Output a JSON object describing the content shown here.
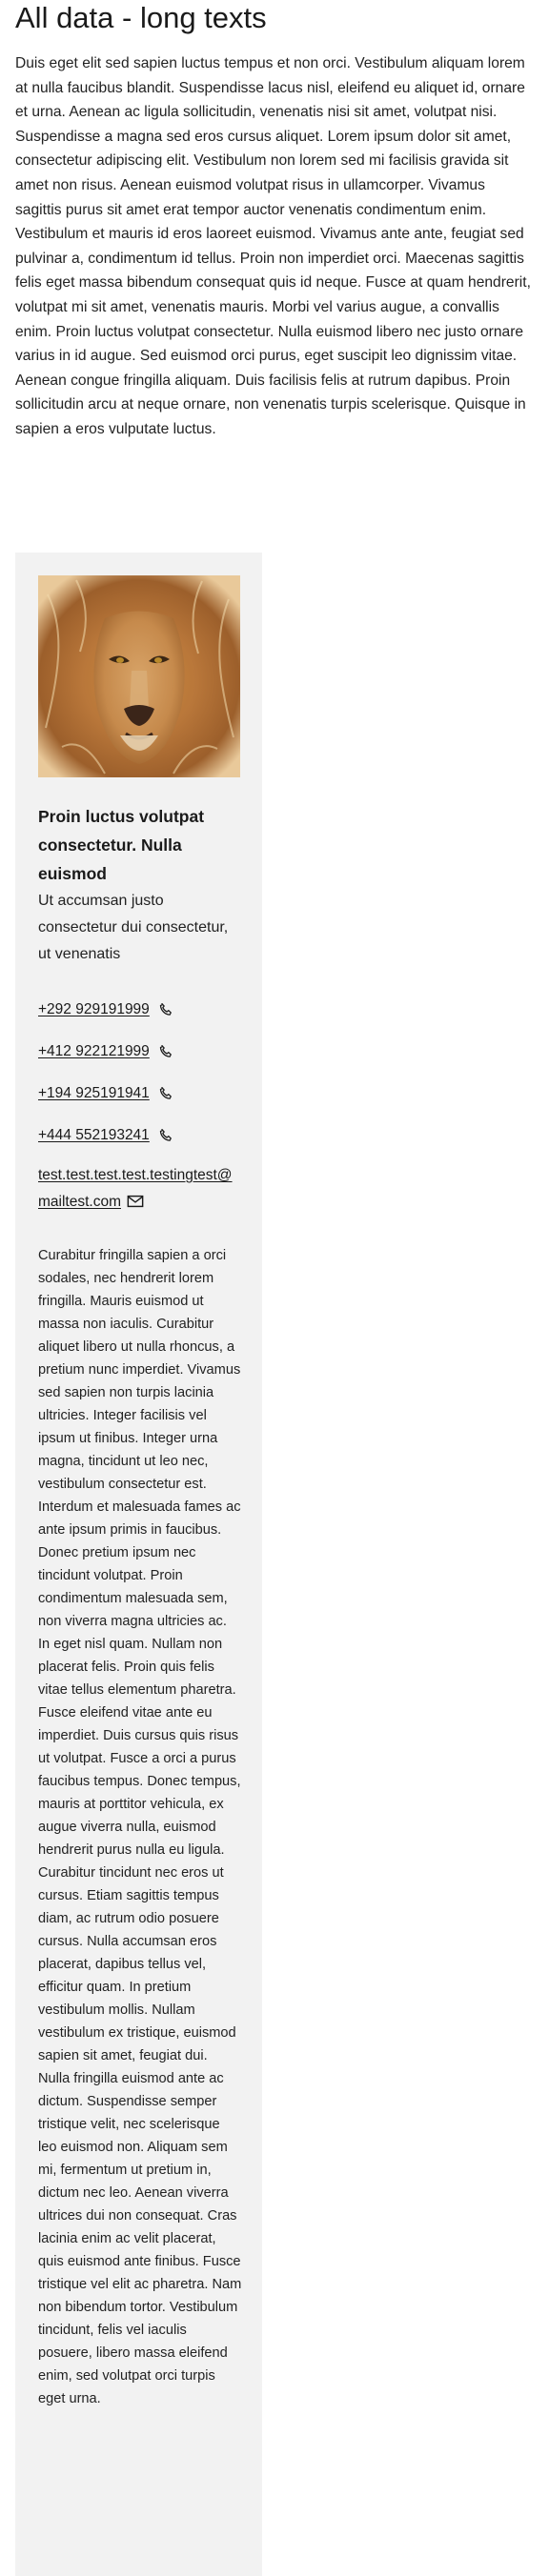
{
  "page": {
    "title": "All data - long texts",
    "intro": "Duis eget elit sed sapien luctus tempus et non orci. Vestibulum aliquam lorem at nulla faucibus blandit. Suspendisse lacus nisl, eleifend eu aliquet id, ornare et urna. Aenean ac ligula sollicitudin, venenatis nisi sit amet, volutpat nisi. Suspendisse a magna sed eros cursus aliquet. Lorem ipsum dolor sit amet, consectetur adipiscing elit. Vestibulum non lorem sed mi facilisis gravida sit amet non risus. Aenean euismod volutpat risus in ullamcorper. Vivamus sagittis purus sit amet erat tempor auctor venenatis condimentum enim. Vestibulum et mauris id eros laoreet euismod. Vivamus ante ante, feugiat sed pulvinar a, condimentum id tellus. Proin non imperdiet orci. Maecenas sagittis felis eget massa bibendum consequat quis id neque. Fusce at quam hendrerit, volutpat mi sit amet, venenatis mauris. Morbi vel varius augue, a convallis enim. Proin luctus volutpat consectetur. Nulla euismod libero nec justo ornare varius in id augue. Sed euismod orci purus, eget suscipit leo dignissim vitae. Aenean congue fringilla aliquam. Duis facilisis felis at rutrum dapibus. Proin sollicitudin arcu at neque ornare, non venenatis turpis scelerisque. Quisque in sapien a eros vulputate luctus."
  },
  "card": {
    "image_icon": "lion-portrait",
    "name": "Proin luctus volutpat consectetur. Nulla euismod",
    "subtitle": "Ut accumsan justo consectetur dui consectetur, ut venenatis",
    "phones": [
      {
        "number": "+292 929191999",
        "icon": "phone-icon"
      },
      {
        "number": "+412 922121999",
        "icon": "phone-icon"
      },
      {
        "number": "+194 925191941",
        "icon": "phone-icon"
      },
      {
        "number": "+444 552193241",
        "icon": "phone-icon"
      }
    ],
    "email": {
      "address": "test.test.test.test.testingtest@mailtest.com",
      "icon": "envelope-icon"
    },
    "bio": "Curabitur fringilla sapien a orci sodales, nec hendrerit lorem fringilla. Mauris euismod ut massa non iaculis. Curabitur aliquet libero ut nulla rhoncus, a pretium nunc imperdiet. Vivamus sed sapien non turpis lacinia ultricies. Integer facilisis vel ipsum ut finibus. Integer urna magna, tincidunt ut leo nec, vestibulum consectetur est. Interdum et malesuada fames ac ante ipsum primis in faucibus. Donec pretium ipsum nec tincidunt volutpat. Proin condimentum malesuada sem, non viverra magna ultricies ac. In eget nisl quam. Nullam non placerat felis. Proin quis felis vitae tellus elementum pharetra. Fusce eleifend vitae ante eu imperdiet. Duis cursus quis risus ut volutpat. Fusce a orci a purus faucibus tempus. Donec tempus, mauris at porttitor vehicula, ex augue viverra nulla, euismod hendrerit purus nulla eu ligula. Curabitur tincidunt nec eros ut cursus. Etiam sagittis tempus diam, ac rutrum odio posuere cursus. Nulla accumsan eros placerat, dapibus tellus vel, efficitur quam. In pretium vestibulum mollis. Nullam vestibulum ex tristique, euismod sapien sit amet, feugiat dui. Nulla fringilla euismod ante ac dictum. Suspendisse semper tristique velit, nec scelerisque leo euismod non. Aliquam sem mi, fermentum ut pretium in, dictum nec leo. Aenean viverra ultrices dui non consequat. Cras lacinia enim ac velit placerat, quis euismod ante finibus. Fusce tristique vel elit ac pharetra. Nam non bibendum tortor. Vestibulum tincidunt, felis vel iaculis posuere, libero massa eleifend enim, sed volutpat orci turpis eget urna."
  },
  "colors": {
    "text": "#1f1f1f",
    "card_background": "#f2f2f2",
    "page_background": "#ffffff"
  }
}
